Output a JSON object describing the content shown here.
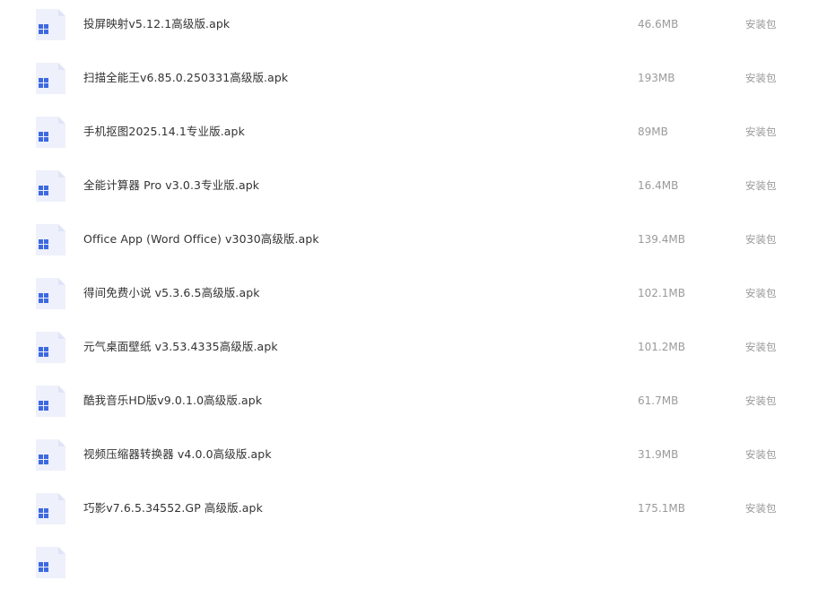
{
  "files": [
    {
      "name": "投屏映射v5.12.1高级版.apk",
      "size": "46.6MB",
      "type": "安装包",
      "icon": "apk-file-icon"
    },
    {
      "name": "扫描全能王v6.85.0.250331高级版.apk",
      "size": "193MB",
      "type": "安装包",
      "icon": "apk-file-icon"
    },
    {
      "name": "手机抠图2025.14.1专业版.apk",
      "size": "89MB",
      "type": "安装包",
      "icon": "apk-file-icon"
    },
    {
      "name": "全能计算器  Pro v3.0.3专业版.apk",
      "size": "16.4MB",
      "type": "安装包",
      "icon": "apk-file-icon"
    },
    {
      "name": "Office App (Word Office) v3030高级版.apk",
      "size": "139.4MB",
      "type": "安装包",
      "icon": "apk-file-icon"
    },
    {
      "name": "得间免费小说 v5.3.6.5高级版.apk",
      "size": "102.1MB",
      "type": "安装包",
      "icon": "apk-file-icon"
    },
    {
      "name": "元气桌面壁纸 v3.53.4335高级版.apk",
      "size": "101.2MB",
      "type": "安装包",
      "icon": "apk-file-icon"
    },
    {
      "name": "酷我音乐HD版v9.0.1.0高级版.apk",
      "size": "61.7MB",
      "type": "安装包",
      "icon": "apk-file-icon"
    },
    {
      "name": "视频压缩器转换器 v4.0.0高级版.apk",
      "size": "31.9MB",
      "type": "安装包",
      "icon": "apk-file-icon"
    },
    {
      "name": "巧影v7.6.5.34552.GP 高级版.apk",
      "size": "175.1MB",
      "type": "安装包",
      "icon": "apk-file-icon"
    },
    {
      "name": "",
      "size": "",
      "type": "",
      "icon": "apk-file-icon"
    }
  ],
  "colors": {
    "icon_body": "#eef1fb",
    "icon_fold": "#dfe5f7",
    "icon_grid": "#3e6ae1",
    "name_text": "#333333",
    "meta_text": "#9a9a9a"
  }
}
